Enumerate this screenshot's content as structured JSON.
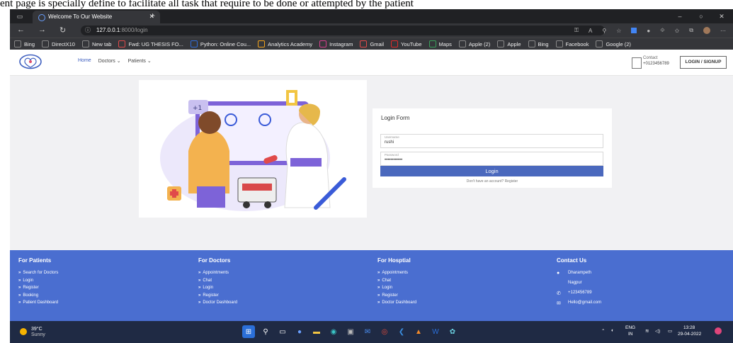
{
  "caption": "ent page is specially define to facilitate all task that require to be done or attempted by the patient",
  "browser": {
    "tab_title": "Welcome To Our Website",
    "url_host": "127.0.0.1",
    "url_rest": ":8000/login",
    "bookmarks": [
      "Bing",
      "DirectX10",
      "New tab",
      "Fwd: UG THESIS FO...",
      "Python: Online Cou...",
      "Analytics Academy",
      "Instagram",
      "Gmail",
      "YouTube",
      "Maps",
      "Apple (2)",
      "Apple",
      "Bing",
      "Facebook",
      "Google (2)"
    ]
  },
  "site": {
    "nav": {
      "home": "Home",
      "doctors": "Doctors",
      "patients": "Patients"
    },
    "contact_label": "Contact",
    "contact_number": "+0123456789",
    "login_signup": "LOGIN / SIGNUP"
  },
  "login_form": {
    "title": "Login Form",
    "username_label": "Username",
    "username_value": "rushi",
    "password_label": "Password",
    "password_value": "••••••••••••",
    "submit_label": "Login",
    "register_text": "Don't have an account? Register"
  },
  "footer": {
    "patients": {
      "title": "For Patients",
      "items": [
        "Search for Doctors",
        "Login",
        "Register",
        "Booking",
        "Patient Dashboard"
      ]
    },
    "doctors": {
      "title": "For Doctors",
      "items": [
        "Appointments",
        "Chat",
        "Login",
        "Register",
        "Doctor Dashboard"
      ]
    },
    "hospital": {
      "title": "For Hosptial",
      "items": [
        "Appointments",
        "Chat",
        "Login",
        "Register",
        "Doctor Dashboard"
      ]
    },
    "contact": {
      "title": "Contact Us",
      "address1": "Dharampeth",
      "address2": "Nagpur",
      "phone": "+123456789",
      "email": "Hello@gmail.com"
    }
  },
  "taskbar": {
    "temp": "39°C",
    "weather": "Sunny",
    "lang1": "ENG",
    "lang2": "IN",
    "time": "13:28",
    "date": "29-04-2022"
  },
  "colors": {
    "footer": "#4a6ed0",
    "login_button": "#4a68bd",
    "taskbar": "#1f2a44"
  }
}
